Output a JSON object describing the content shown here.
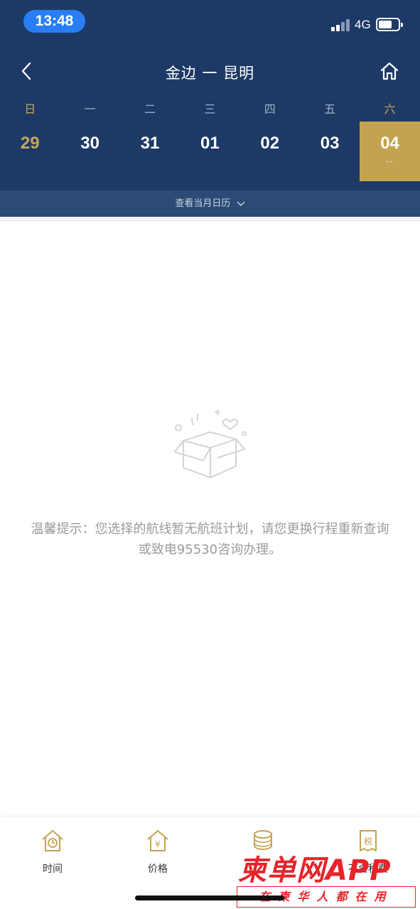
{
  "status_bar": {
    "time": "13:48",
    "network": "4G"
  },
  "header": {
    "title": "金边 一 昆明",
    "back_icon": "chevron-left-icon",
    "home_icon": "home-icon"
  },
  "calendar": {
    "weekdays": [
      "日",
      "一",
      "二",
      "三",
      "四",
      "五",
      "六"
    ],
    "dates": [
      "29",
      "30",
      "31",
      "01",
      "02",
      "03",
      "04"
    ],
    "selected_index": 6,
    "selected_sub": "--",
    "month_link": "查看当月日历"
  },
  "empty_state": {
    "icon": "empty-box-icon",
    "line1": "温馨提示：您选择的航线暂无航班计划，请您更换行程重新查询",
    "line2": "或致电95530咨询办理。"
  },
  "bottom_tabs": [
    {
      "label": "时间",
      "icon": "clock-house-icon"
    },
    {
      "label": "价格",
      "icon": "yen-house-icon"
    },
    {
      "label": "",
      "icon": "coin-stack-icon"
    },
    {
      "label": "不含税费",
      "icon": "tax-receipt-icon"
    }
  ],
  "watermark": {
    "big": "柬单网APP",
    "small": "在柬华人都在用"
  },
  "colors": {
    "header_bg": "#1d3a66",
    "gold": "#c4a350",
    "month_bar": "#2b4a75"
  }
}
